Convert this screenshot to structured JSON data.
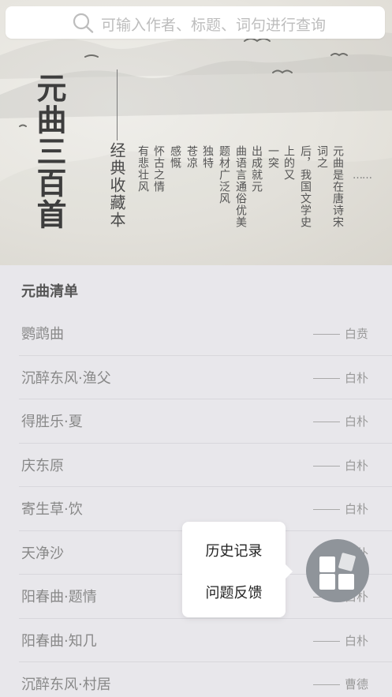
{
  "search": {
    "placeholder": "可输入作者、标题、词句进行查询"
  },
  "hero": {
    "title": "元曲三百首",
    "subtitle": "经典收藏本",
    "intro_columns": [
      "元曲是在唐诗宋",
      "词之",
      "后，我国文学史",
      "上的又",
      "一突",
      "出成就元",
      "曲语言通俗优美",
      "题材广泛风",
      "独特",
      "苍凉",
      "感慨",
      "怀古之情",
      "有悲壮风"
    ],
    "more_dots": "……"
  },
  "list": {
    "header": "元曲清单",
    "items": [
      {
        "title": "鹦鹉曲",
        "author": "白贲"
      },
      {
        "title": "沉醉东风·渔父",
        "author": "白朴"
      },
      {
        "title": "得胜乐·夏",
        "author": "白朴"
      },
      {
        "title": "庆东原",
        "author": "白朴"
      },
      {
        "title": "寄生草·饮",
        "author": "白朴"
      },
      {
        "title": "天净沙",
        "author": "白朴"
      },
      {
        "title": "阳春曲·题情",
        "author": "白朴"
      },
      {
        "title": "阳春曲·知几",
        "author": "白朴"
      },
      {
        "title": "沉醉东风·村居",
        "author": "曹德"
      }
    ]
  },
  "popup": {
    "items": [
      "历史记录",
      "问题反馈"
    ]
  },
  "colors": {
    "background": "#e8e7eb",
    "fab": "#8f949a",
    "hero_ink": "#3d3d3d"
  }
}
